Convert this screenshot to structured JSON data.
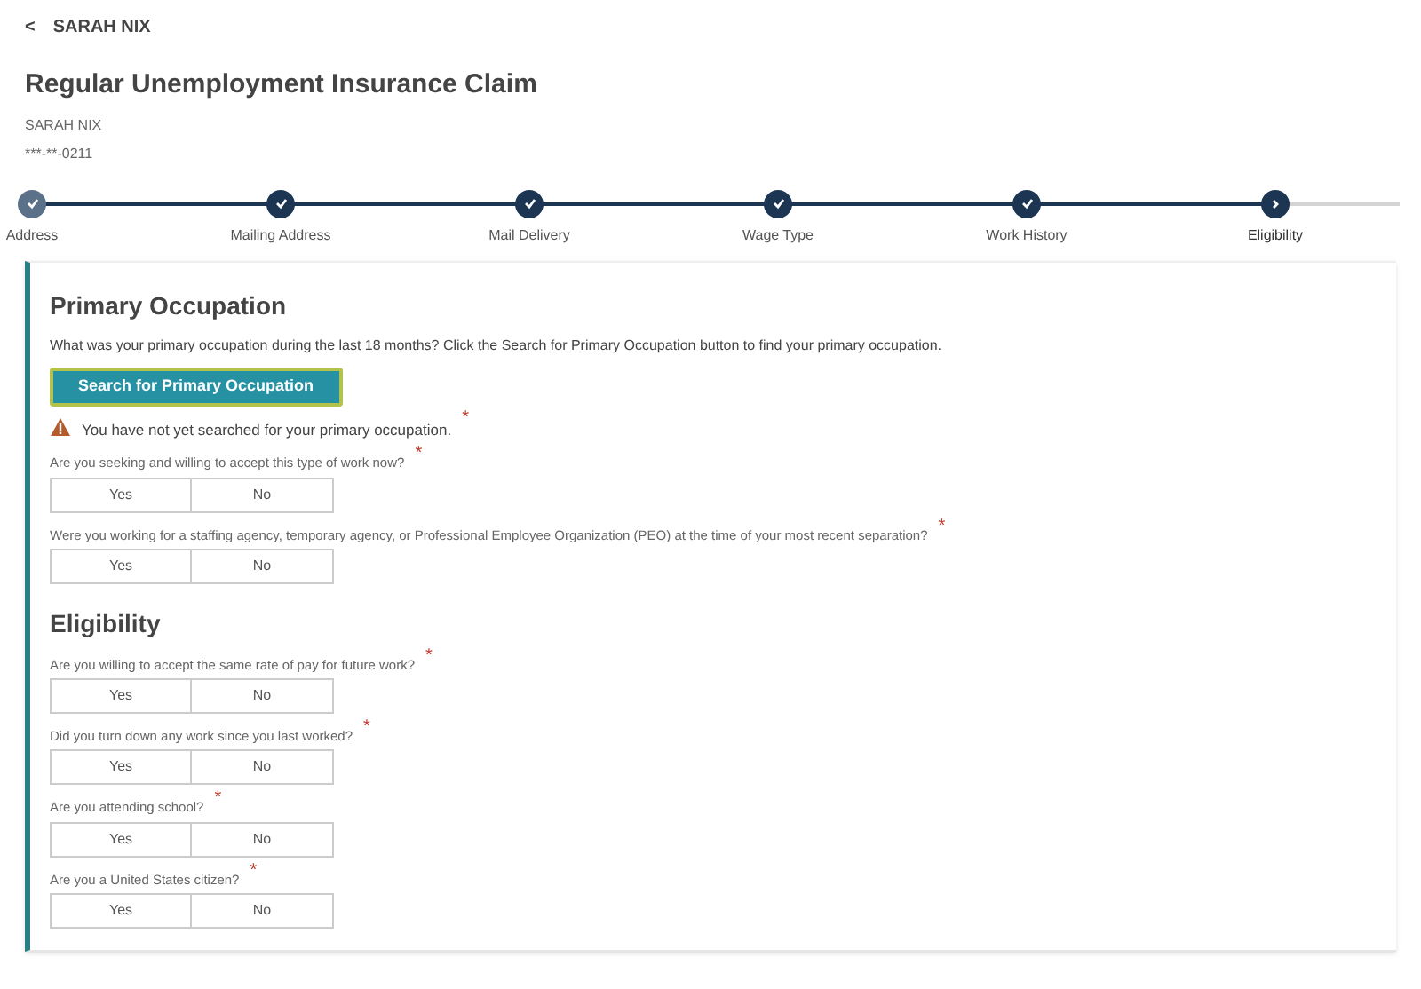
{
  "back_link": {
    "icon": "<",
    "label": "SARAH NIX"
  },
  "title": "Regular Unemployment Insurance Claim",
  "claimant": {
    "name": "SARAH NIX",
    "ssn": "***-**-0211"
  },
  "steps": [
    {
      "label": "Address",
      "completed": true,
      "current": false
    },
    {
      "label": "Mailing Address",
      "completed": true,
      "current": false
    },
    {
      "label": "Mail Delivery",
      "completed": true,
      "current": false
    },
    {
      "label": "Wage Type",
      "completed": true,
      "current": false
    },
    {
      "label": "Work History",
      "completed": true,
      "current": false
    },
    {
      "label": "Eligibility",
      "completed": false,
      "current": true
    }
  ],
  "sections": [
    {
      "heading": "Primary Occupation",
      "intro": "What was your primary occupation during the last 18 months? Click the Search for Primary Occupation button to find your primary occupation.",
      "search_button": "Search for Primary Occupation",
      "warning": {
        "text": "You have not yet searched for your primary occupation.",
        "required_mark": "*"
      },
      "questions": [
        {
          "text": "Are you seeking and willing to accept this type of work now?",
          "required_mark": "*",
          "options": [
            {
              "label": "Yes",
              "selected": false
            },
            {
              "label": "No",
              "selected": false
            }
          ]
        },
        {
          "text": "Were you working for a staffing agency, temporary agency, or Professional Employee Organization (PEO) at the time of your most recent separation?",
          "required_mark": "*",
          "options": [
            {
              "label": "Yes",
              "selected": false
            },
            {
              "label": "No",
              "selected": false
            }
          ]
        }
      ]
    },
    {
      "heading": "Eligibility",
      "questions": [
        {
          "text": "Are you willing to accept the same rate of pay for future work?",
          "required_mark": "*",
          "options": [
            {
              "label": "Yes",
              "selected": false
            },
            {
              "label": "No",
              "selected": false
            }
          ]
        },
        {
          "text": "Did you turn down any work since you last worked?",
          "required_mark": "*",
          "options": [
            {
              "label": "Yes",
              "selected": false
            },
            {
              "label": "No",
              "selected": false
            }
          ]
        },
        {
          "text": "Are you attending school?",
          "required_mark": "*",
          "options": [
            {
              "label": "Yes",
              "selected": false
            },
            {
              "label": "No",
              "selected": false
            }
          ]
        },
        {
          "text": "Are you a United States citizen?",
          "required_mark": "*",
          "options": [
            {
              "label": "Yes",
              "selected": false
            },
            {
              "label": "No",
              "selected": false
            }
          ]
        }
      ]
    }
  ]
}
